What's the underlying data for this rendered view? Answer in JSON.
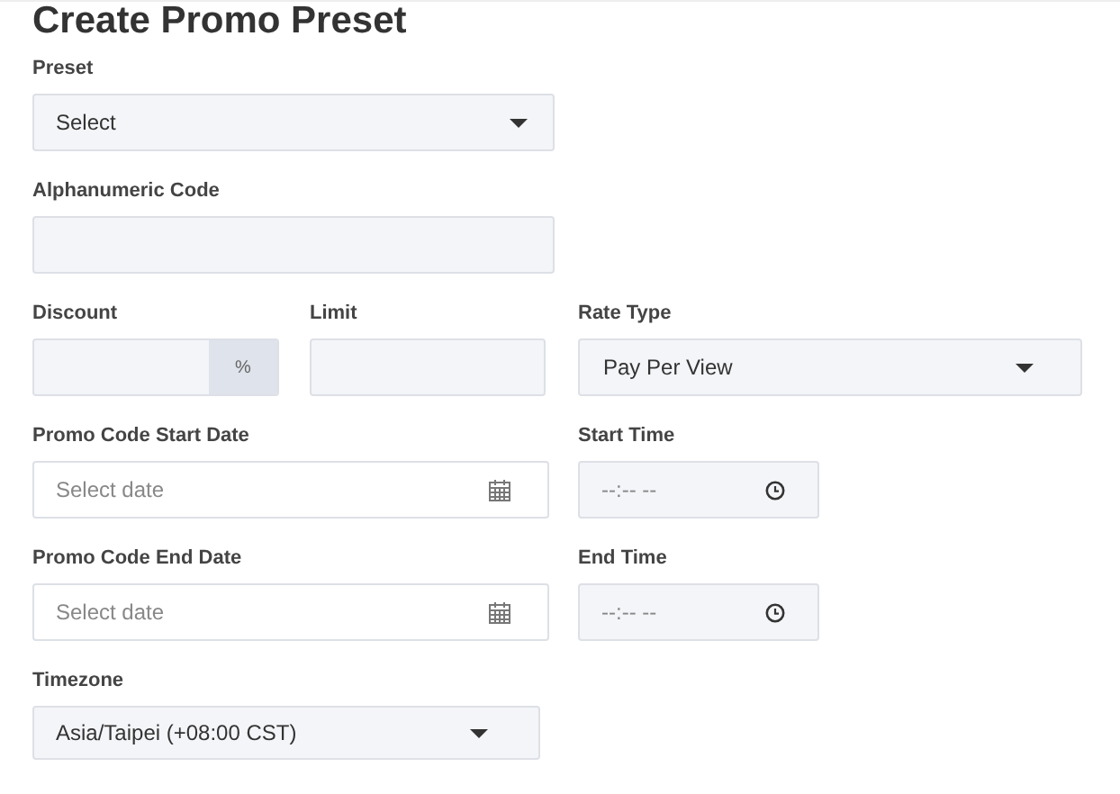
{
  "title": "Create Promo Preset",
  "preset": {
    "label": "Preset",
    "value": "Select"
  },
  "code": {
    "label": "Alphanumeric Code"
  },
  "discount": {
    "label": "Discount",
    "addon": "%"
  },
  "limit": {
    "label": "Limit"
  },
  "rate_type": {
    "label": "Rate Type",
    "value": "Pay Per View"
  },
  "start_date": {
    "label": "Promo Code Start Date",
    "placeholder": "Select date"
  },
  "start_time": {
    "label": "Start Time",
    "placeholder": "--:-- --"
  },
  "end_date": {
    "label": "Promo Code End Date",
    "placeholder": "Select date"
  },
  "end_time": {
    "label": "End Time",
    "placeholder": "--:-- --"
  },
  "timezone": {
    "label": "Timezone",
    "value": "Asia/Taipei (+08:00 CST)"
  }
}
